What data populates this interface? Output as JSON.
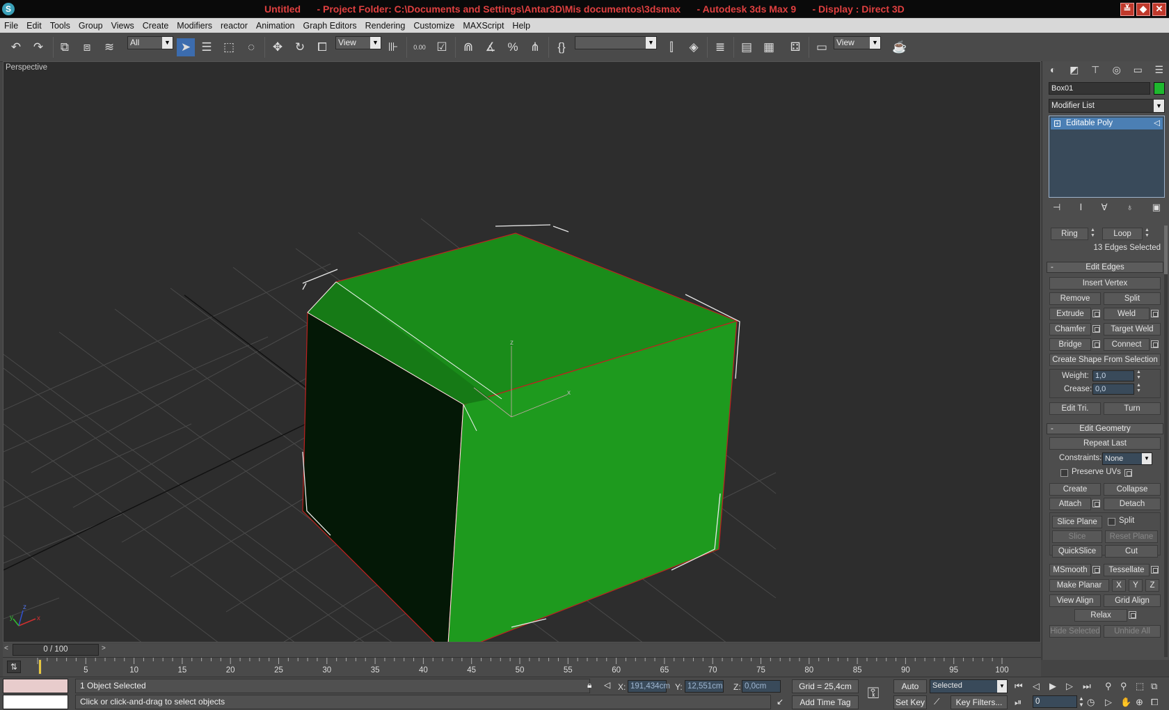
{
  "window": {
    "title": "Untitled      - Project Folder: C:\\Documents and Settings\\Antar3D\\Mis documentos\\3dsmax      - Autodesk 3ds Max 9      - Display : Direct 3D",
    "app_icon": "S",
    "buttons": {
      "minimize": "≚",
      "restore": "◆",
      "close": "✕"
    }
  },
  "menu": [
    "File",
    "Edit",
    "Tools",
    "Group",
    "Views",
    "Create",
    "Modifiers",
    "reactor",
    "Animation",
    "Graph Editors",
    "Rendering",
    "Customize",
    "MAXScript",
    "Help"
  ],
  "toolbar": {
    "selection_filter": "All",
    "reference_coord": "View",
    "snap_value": "0.00",
    "named_selection": "",
    "render_view": "View"
  },
  "viewport": {
    "label": "Perspective",
    "axes": {
      "x": "x",
      "y": "y",
      "z": "z"
    },
    "gizmo": {
      "x": "x",
      "z": "z"
    },
    "object_color": "#1e8c1e",
    "edge_color": "#c02020"
  },
  "panel": {
    "object_name": "Box01",
    "object_color": "#1eb82e",
    "modifier_list": "Modifier List",
    "stack_item": "Editable Poly",
    "stack_expand": "+",
    "ring": "Ring",
    "loop": "Loop",
    "edges_selected": "13 Edges Selected",
    "edit_edges": {
      "title": "Edit Edges",
      "collapse": "-",
      "insert_vertex": "Insert Vertex",
      "remove": "Remove",
      "split": "Split",
      "extrude": "Extrude",
      "weld": "Weld",
      "chamfer": "Chamfer",
      "target_weld": "Target Weld",
      "bridge": "Bridge",
      "connect": "Connect",
      "create_shape": "Create Shape From Selection",
      "weight_label": "Weight:",
      "weight_value": "1,0",
      "crease_label": "Crease:",
      "crease_value": "0,0",
      "edit_tri": "Edit Tri.",
      "turn": "Turn"
    },
    "edit_geometry": {
      "title": "Edit Geometry",
      "collapse": "-",
      "repeat_last": "Repeat Last",
      "constraints_label": "Constraints:",
      "constraints_value": "None",
      "preserve_uvs": "Preserve UVs",
      "create": "Create",
      "collapse_btn": "Collapse",
      "attach": "Attach",
      "detach": "Detach",
      "slice_plane": "Slice Plane",
      "split": "Split",
      "slice": "Slice",
      "reset_plane": "Reset Plane",
      "quickslice": "QuickSlice",
      "cut": "Cut",
      "msmooth": "MSmooth",
      "tessellate": "Tessellate",
      "make_planar": "Make Planar",
      "x": "X",
      "y": "Y",
      "z": "Z",
      "view_align": "View Align",
      "grid_align": "Grid Align",
      "relax": "Relax",
      "hide_selected": "Hide Selected",
      "unhide_all": "Unhide All"
    }
  },
  "timeline": {
    "frame_display": "0 / 100",
    "prev": "<",
    "next": ">",
    "ticks": [
      "5",
      "10",
      "15",
      "20",
      "25",
      "30",
      "35",
      "40",
      "45",
      "50",
      "55",
      "60",
      "65",
      "70",
      "75",
      "80",
      "85",
      "90",
      "95",
      "100"
    ]
  },
  "status": {
    "selection": "1 Object Selected",
    "prompt": "Click or click-and-drag to select objects",
    "x_label": "X:",
    "x_value": "191,434cm",
    "y_label": "Y:",
    "y_value": "12,551cm",
    "z_label": "Z:",
    "z_value": "0,0cm",
    "grid": "Grid = 25,4cm",
    "add_time_tag": "Add Time Tag",
    "auto_key": "Auto Key",
    "set_key": "Set Key",
    "key_mode": "Selected",
    "key_filters": "Key Filters...",
    "current_frame": "0"
  }
}
